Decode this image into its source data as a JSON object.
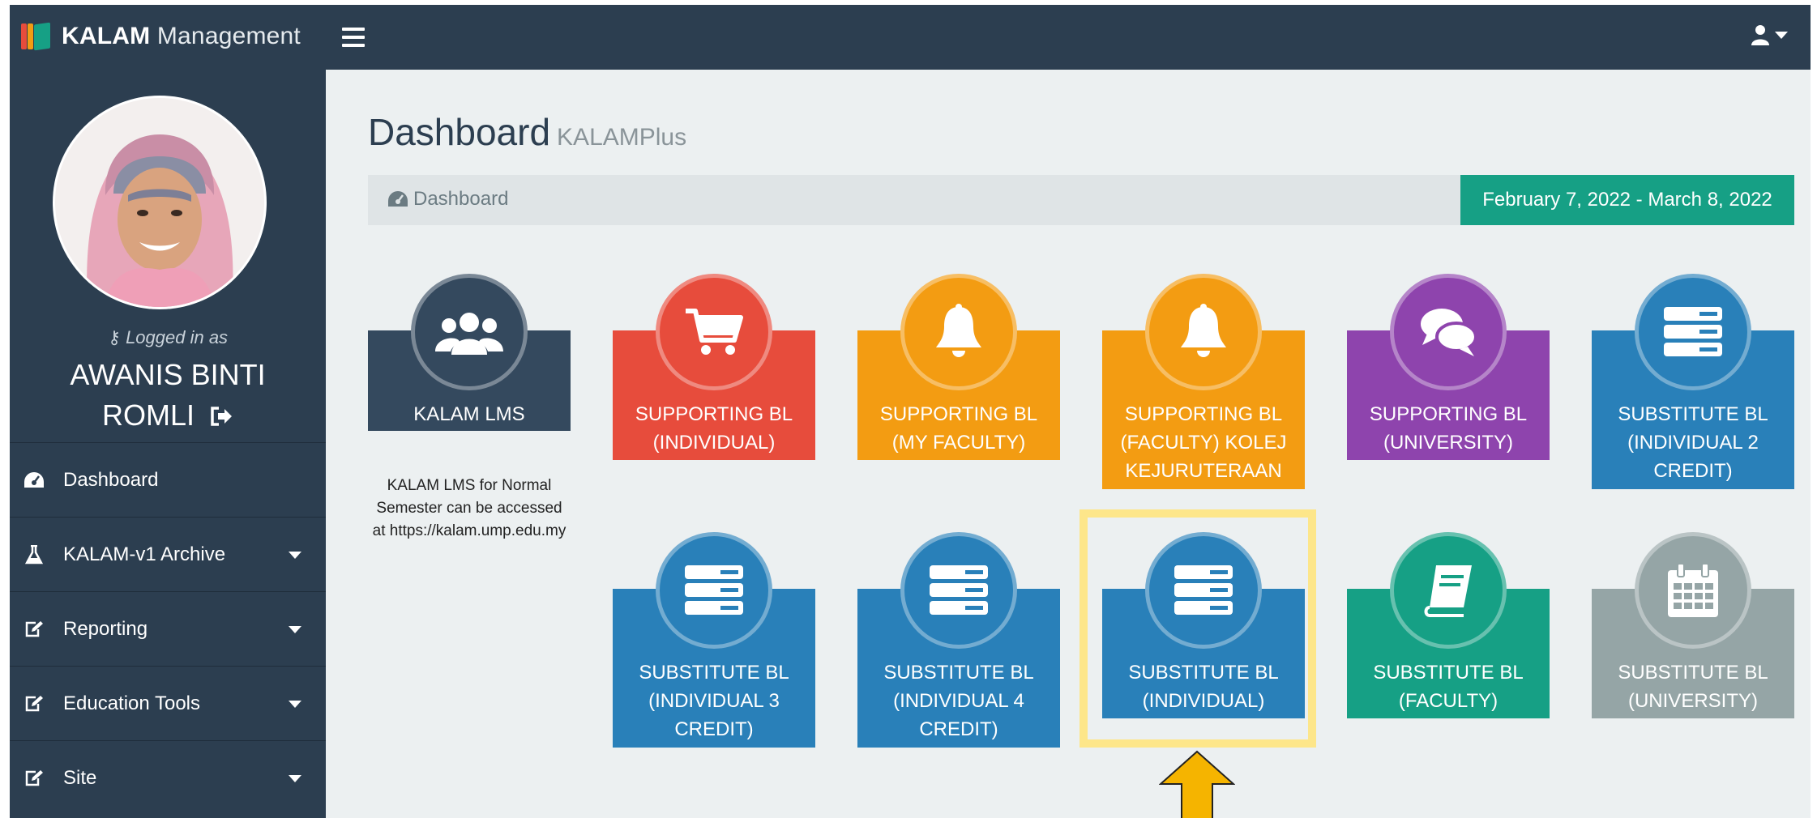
{
  "header": {
    "brand_bold": "KALAM",
    "brand_light": "Management"
  },
  "sidebar": {
    "logged_in_label": "Logged in as",
    "user_name": "AWANIS BINTI ROMLI",
    "items": [
      {
        "label": "Dashboard",
        "icon": "dashboard-icon"
      },
      {
        "label": "KALAM-v1 Archive",
        "icon": "flask-icon"
      },
      {
        "label": "Reporting",
        "icon": "edit-icon"
      },
      {
        "label": "Education Tools",
        "icon": "edit-icon"
      },
      {
        "label": "Site",
        "icon": "edit-icon"
      }
    ]
  },
  "main": {
    "title": "Dashboard",
    "subtitle": "KALAMPlus",
    "breadcrumb": "Dashboard",
    "date_range": "February 7, 2022 - March 8, 2022",
    "lms_description": "KALAM LMS for Normal Semester can be accessed at https://kalam.ump.edu.my",
    "tiles": [
      {
        "label": "KALAM LMS",
        "icon": "users-icon",
        "color": "#34495e"
      },
      {
        "label": "SUPPORTING BL (INDIVIDUAL)",
        "icon": "cart-icon",
        "color": "#e74c3c"
      },
      {
        "label": "SUPPORTING BL (MY FACULTY)",
        "icon": "bell-icon",
        "color": "#f39c12"
      },
      {
        "label": "SUPPORTING BL (FACULTY) KOLEJ KEJURUTERAAN",
        "icon": "bell-icon",
        "color": "#f39c12"
      },
      {
        "label": "SUPPORTING BL (UNIVERSITY)",
        "icon": "chat-icon",
        "color": "#8e44ad"
      },
      {
        "label": "SUBSTITUTE BL (INDIVIDUAL 2 CREDIT)",
        "icon": "server-icon",
        "color": "#2980b9"
      },
      {
        "label": "SUBSTITUTE BL (INDIVIDUAL 3 CREDIT)",
        "icon": "server-icon",
        "color": "#2980b9"
      },
      {
        "label": "SUBSTITUTE BL (INDIVIDUAL 4 CREDIT)",
        "icon": "server-icon",
        "color": "#2980b9"
      },
      {
        "label": "SUBSTITUTE BL (INDIVIDUAL)",
        "icon": "server-icon",
        "color": "#2980b9"
      },
      {
        "label": "SUBSTITUTE BL (FACULTY)",
        "icon": "book-icon",
        "color": "#16a085"
      },
      {
        "label": "SUBSTITUTE BL (UNIVERSITY)",
        "icon": "calendar-icon",
        "color": "#95a5a6"
      }
    ]
  },
  "colors": {
    "navbar": "#2c3e50",
    "content_bg": "#ecf0f1",
    "date_badge": "#16a085",
    "highlight": "#fde68a",
    "pointer": "#f5b400"
  }
}
